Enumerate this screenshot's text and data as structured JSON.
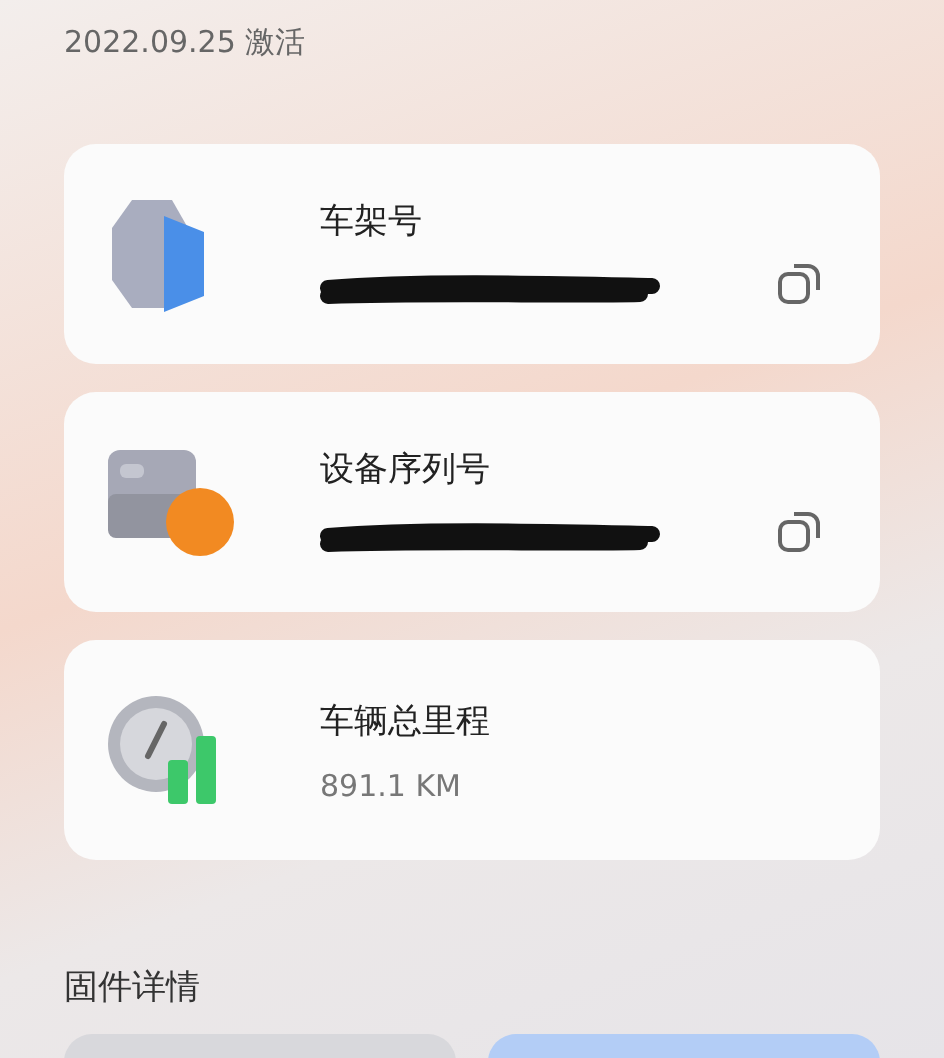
{
  "activation_date": "2022.09.25 激活",
  "info_cards": [
    {
      "kind": "vin",
      "label": "车架号",
      "redacted": true,
      "copyable": true
    },
    {
      "kind": "device",
      "label": "设备序列号",
      "redacted": true,
      "copyable": true
    },
    {
      "kind": "odometer",
      "label": "车辆总里程",
      "redacted": false,
      "value": "891.1 KM",
      "copyable": false
    }
  ],
  "section_title": "固件详情"
}
